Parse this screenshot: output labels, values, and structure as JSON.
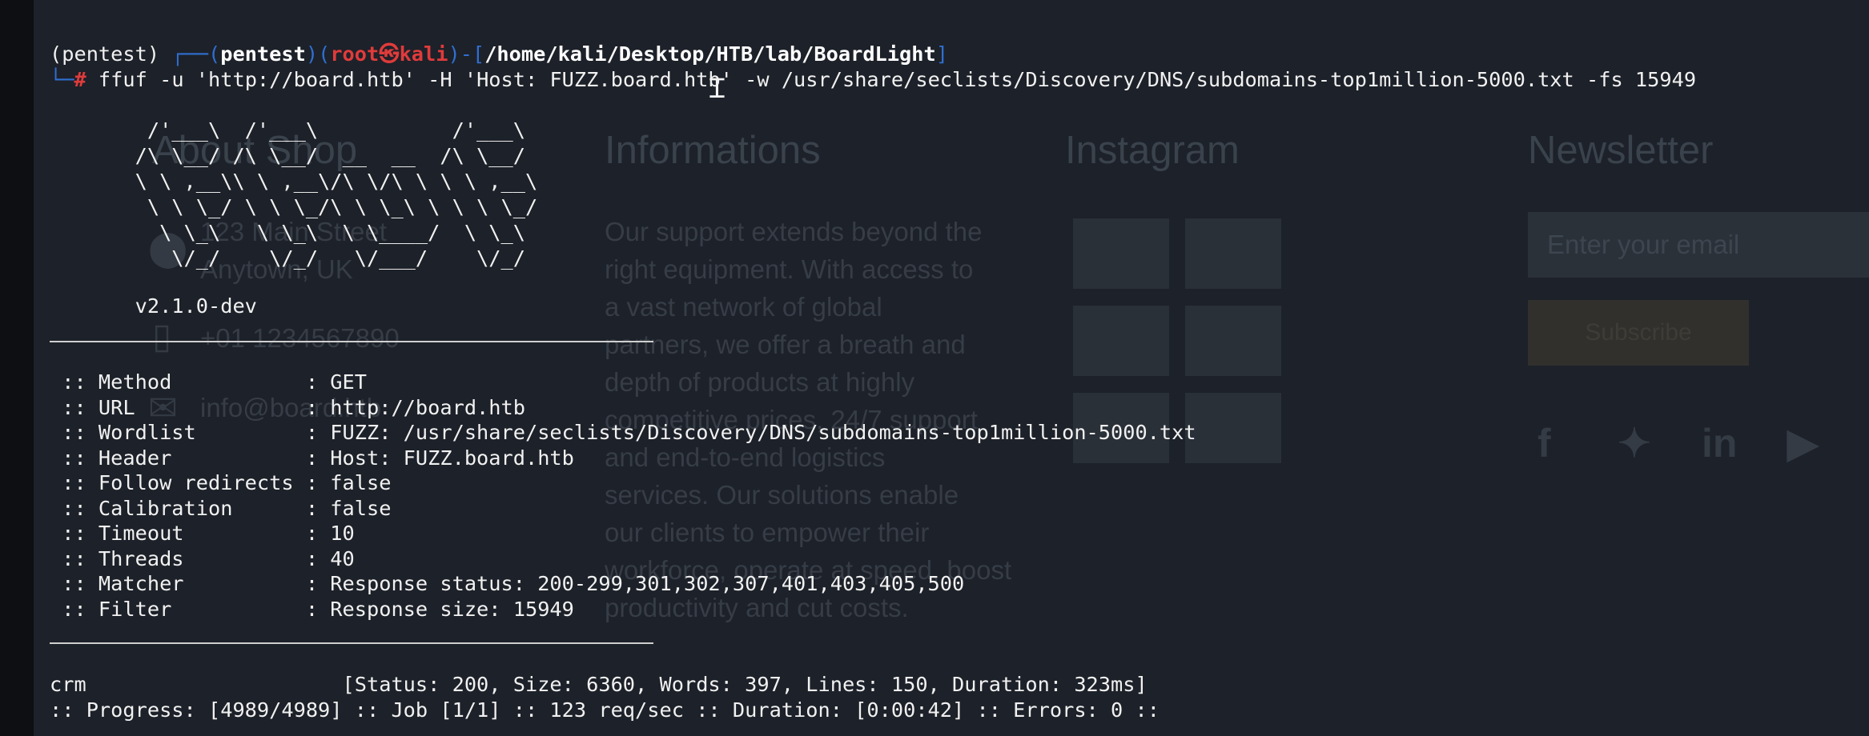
{
  "prompt": {
    "venv": "(pentest)",
    "box_open": "┌──(",
    "user": "pentest",
    "paren_close": ")",
    "root_paren_open": "(",
    "root_user": "root",
    "at_icon": "㉿",
    "host": "kali",
    "dash_bracket": ")-[",
    "path": "/home/kali/Desktop/HTB/lab/BoardLight",
    "bracket_close": "]",
    "box_close": "└─",
    "hash": "#"
  },
  "command": " ffuf -u 'http://board.htb' -H 'Host: FUZZ.board.htb' -w /usr/share/seclists/Discovery/DNS/subdomains-top1million-5000.txt -fs 15949",
  "banner": [
    "        /'___\\  /'___\\           /'___\\       ",
    "       /\\ \\__/ /\\ \\__/  __  __  /\\ \\__/       ",
    "       \\ \\ ,__\\\\ \\ ,__\\/\\ \\/\\ \\ \\ \\ ,__\\      ",
    "        \\ \\ \\_/ \\ \\ \\_/\\ \\ \\_\\ \\ \\ \\ \\_/      ",
    "         \\ \\_\\   \\ \\_\\  \\ \\____/  \\ \\_\\       ",
    "          \\/_/    \\/_/   \\/___/    \\/_/       "
  ],
  "version": "       v2.1.0-dev",
  "config": [
    " :: Method           : GET",
    " :: URL              : http://board.htb",
    " :: Wordlist         : FUZZ: /usr/share/seclists/Discovery/DNS/subdomains-top1million-5000.txt",
    " :: Header           : Host: FUZZ.board.htb",
    " :: Follow redirects : false",
    " :: Calibration      : false",
    " :: Timeout          : 10",
    " :: Threads          : 40",
    " :: Matcher          : Response status: 200-299,301,302,307,401,403,405,500",
    " :: Filter           : Response size: 15949"
  ],
  "result": "crm                     [Status: 200, Size: 6360, Words: 397, Lines: 150, Duration: 323ms]",
  "progress": ":: Progress: [4989/4989] :: Job [1/1] :: 123 req/sec :: Duration: [0:00:42] :: Errors: 0 ::",
  "background_site": {
    "col1_heading": "About Shop",
    "address_line1": "123 Main Street",
    "address_line2": "Anytown, UK",
    "phone": "+01 1234567890",
    "email": "info@board.htb",
    "col2_heading": "Informations",
    "col2_text": [
      "Our support extends beyond the",
      "right equipment. With access to",
      "a vast network of global",
      "partners, we offer a breath and",
      "depth of products at highly",
      "competitive prices, 24/7 support",
      "and end-to-end logistics",
      "services. Our solutions enable",
      "our clients to empower their",
      "workforce, operate at speed, boost",
      "productivity and cut costs."
    ],
    "col3_heading": "Instagram",
    "col4_heading": "Newsletter",
    "newsletter_placeholder": "Enter your email",
    "subscribe_label": "Subscribe"
  },
  "colors": {
    "terminal_bg": "#1d2129",
    "prompt_blue": "#2f6fd1",
    "prompt_red": "#e03b3b",
    "text": "#f1f1f1"
  }
}
